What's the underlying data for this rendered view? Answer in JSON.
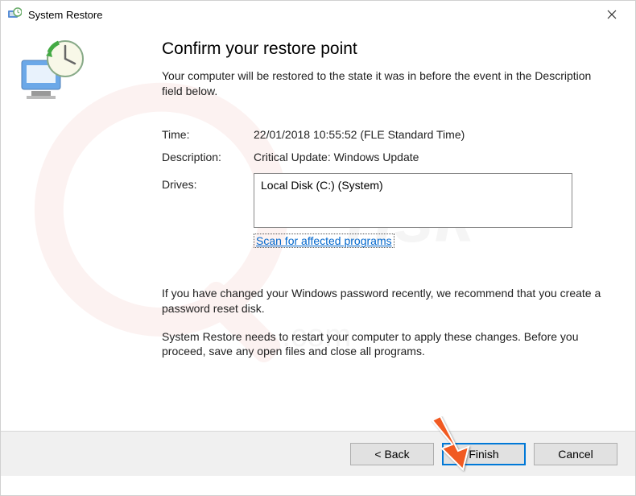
{
  "title": "System Restore",
  "heading": "Confirm your restore point",
  "subtext": "Your computer will be restored to the state it was in before the event in the Description field below.",
  "fields": {
    "time_label": "Time:",
    "time_value": "22/01/2018 10:55:52 (FLE Standard Time)",
    "description_label": "Description:",
    "description_value": "Critical Update: Windows Update",
    "drives_label": "Drives:",
    "drives_value": "Local Disk (C:) (System)"
  },
  "scan_link": "Scan for affected programs",
  "note1": "If you have changed your Windows password recently, we recommend that you create a password reset disk.",
  "note2": "System Restore needs to restart your computer to apply these changes. Before you proceed, save any open files and close all programs.",
  "buttons": {
    "back": "< Back",
    "finish": "Finish",
    "cancel": "Cancel"
  }
}
